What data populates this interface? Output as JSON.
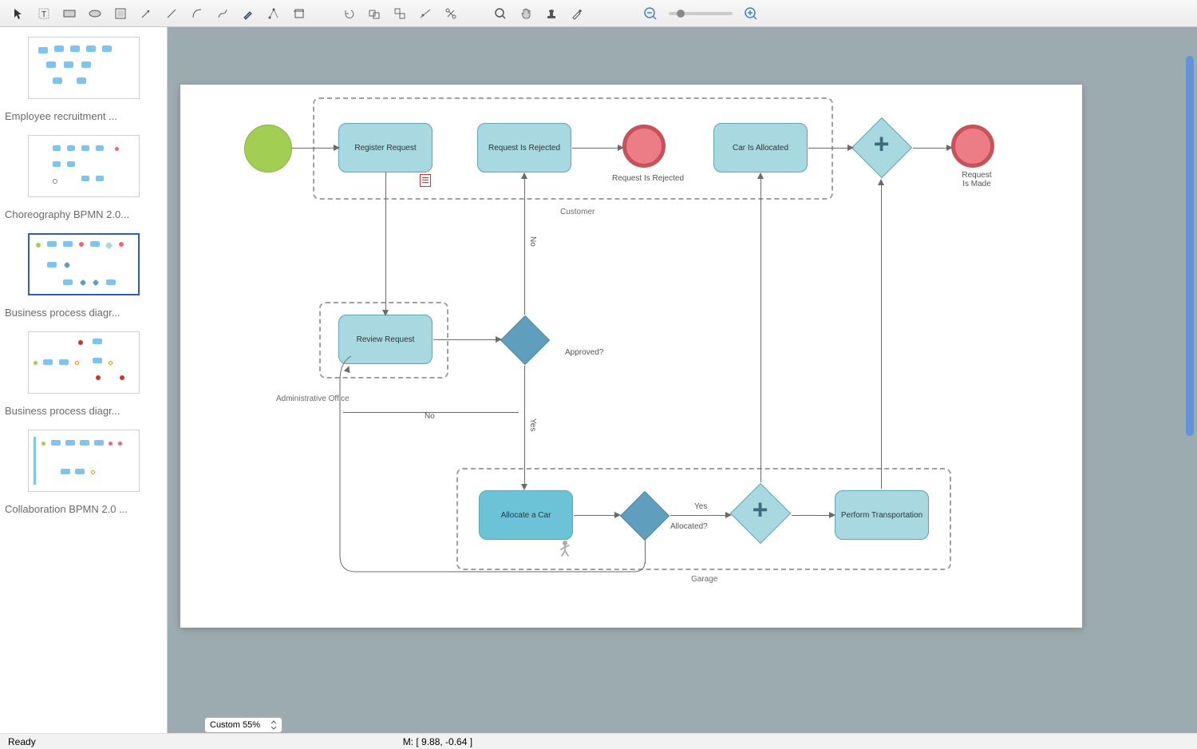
{
  "toolbar": {
    "icons": [
      "pointer",
      "text",
      "rect",
      "ellipse",
      "group",
      "arrow",
      "line",
      "arc",
      "curve",
      "pen",
      "path-edit",
      "crop",
      "undo",
      "group-shapes",
      "ungroup",
      "align",
      "connect",
      "zoom-in-tool",
      "pan",
      "stamp",
      "eyedropper",
      "zoom-out",
      "zoom-in"
    ]
  },
  "sidebar": {
    "thumbs": [
      {
        "label": "Employee recruitment ...",
        "selected": false
      },
      {
        "label": "Choreography BPMN 2.0...",
        "selected": false
      },
      {
        "label": "Business process diagr...",
        "selected": true
      },
      {
        "label": "Business process diagr...",
        "selected": false
      },
      {
        "label": "Collaboration BPMN 2.0 ...",
        "selected": false
      }
    ]
  },
  "diagram": {
    "pools": {
      "customer": "Customer",
      "admin": "Administrative Office",
      "garage": "Garage"
    },
    "tasks": {
      "register": "Register Request",
      "reject": "Request Is Rejected",
      "carAllocated": "Car Is Allocated",
      "review": "Review Request",
      "allocate": "Allocate a Car",
      "perform": "Perform Transportation"
    },
    "events": {
      "rejected": "Request Is Rejected",
      "made": "Request\nIs Made"
    },
    "gateways": {
      "approved": "Approved?",
      "allocated": "Allocated?"
    },
    "edges": {
      "no_vert": "No",
      "yes_vert": "Yes",
      "no": "No",
      "yes": "Yes"
    }
  },
  "zoom_select": "Custom 55%",
  "status": {
    "ready": "Ready",
    "coords": "M: [ 9.88, -0.64 ]"
  }
}
